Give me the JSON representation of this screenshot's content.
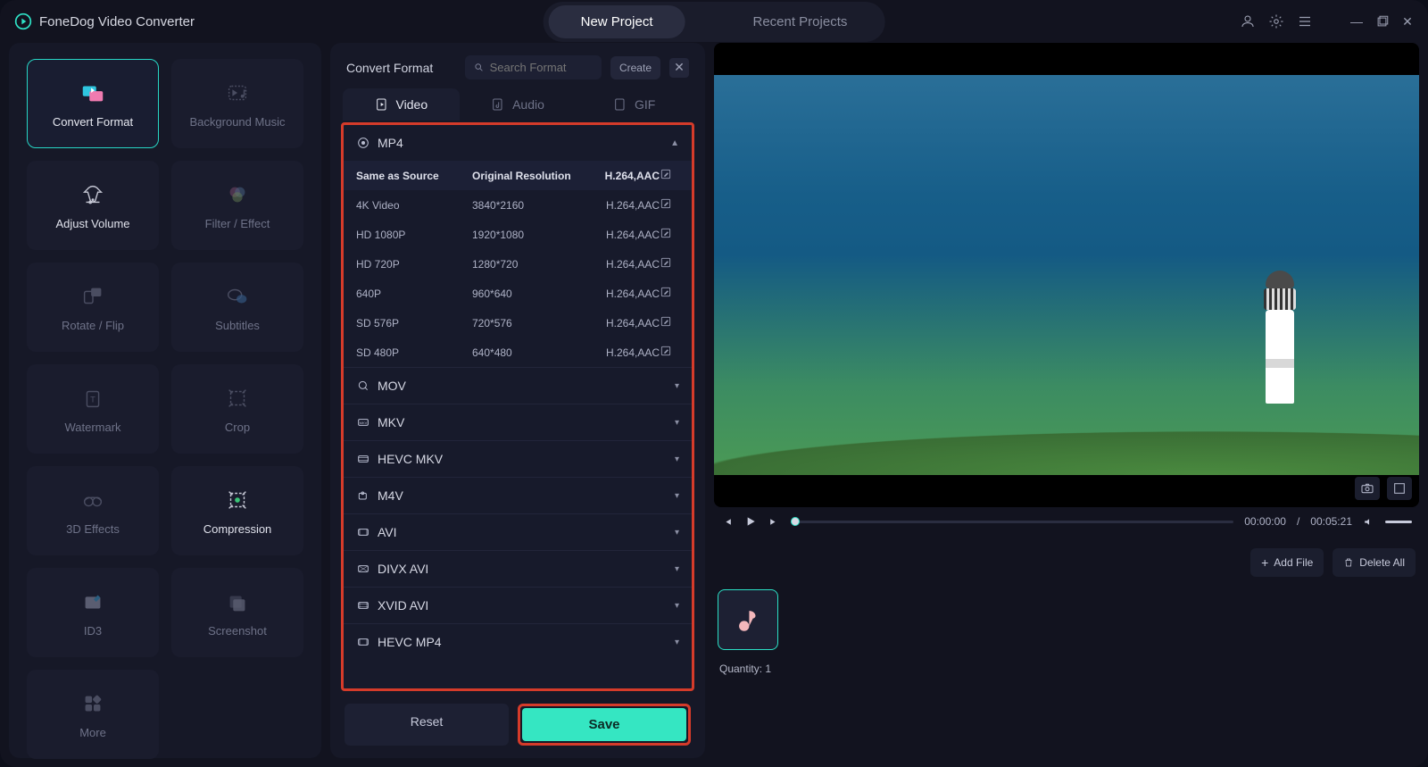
{
  "app": {
    "title": "FoneDog Video Converter",
    "tabs": {
      "new": "New Project",
      "recent": "Recent Projects"
    }
  },
  "tools": [
    {
      "name": "convert-format",
      "label": "Convert Format",
      "active": true
    },
    {
      "name": "background-music",
      "label": "Background Music"
    },
    {
      "name": "adjust-volume",
      "label": "Adjust Volume",
      "bright": true
    },
    {
      "name": "filter-effect",
      "label": "Filter / Effect"
    },
    {
      "name": "rotate-flip",
      "label": "Rotate / Flip"
    },
    {
      "name": "subtitles",
      "label": "Subtitles"
    },
    {
      "name": "watermark",
      "label": "Watermark"
    },
    {
      "name": "crop",
      "label": "Crop"
    },
    {
      "name": "3d-effects",
      "label": "3D Effects"
    },
    {
      "name": "compression",
      "label": "Compression",
      "bright": true
    },
    {
      "name": "id3",
      "label": "ID3"
    },
    {
      "name": "screenshot",
      "label": "Screenshot"
    },
    {
      "name": "more",
      "label": "More"
    }
  ],
  "formatPanel": {
    "title": "Convert Format",
    "searchPlaceholder": "Search Format",
    "createLabel": "Create",
    "tabs": {
      "video": "Video",
      "audio": "Audio",
      "gif": "GIF"
    },
    "expanded": {
      "name": "MP4",
      "head": {
        "c1": "Same as Source",
        "c2": "Original Resolution",
        "c3": "H.264,AAC"
      },
      "rows": [
        {
          "c1": "4K Video",
          "c2": "3840*2160",
          "c3": "H.264,AAC"
        },
        {
          "c1": "HD 1080P",
          "c2": "1920*1080",
          "c3": "H.264,AAC"
        },
        {
          "c1": "HD 720P",
          "c2": "1280*720",
          "c3": "H.264,AAC"
        },
        {
          "c1": "640P",
          "c2": "960*640",
          "c3": "H.264,AAC"
        },
        {
          "c1": "SD 576P",
          "c2": "720*576",
          "c3": "H.264,AAC"
        },
        {
          "c1": "SD 480P",
          "c2": "640*480",
          "c3": "H.264,AAC"
        }
      ]
    },
    "collapsed": [
      "MOV",
      "MKV",
      "HEVC MKV",
      "M4V",
      "AVI",
      "DIVX AVI",
      "XVID AVI",
      "HEVC MP4"
    ],
    "reset": "Reset",
    "save": "Save"
  },
  "player": {
    "current": "00:00:00",
    "total": "00:05:21"
  },
  "fileOps": {
    "add": "Add File",
    "deleteAll": "Delete All"
  },
  "quantity": {
    "label": "Quantity:",
    "value": "1"
  }
}
